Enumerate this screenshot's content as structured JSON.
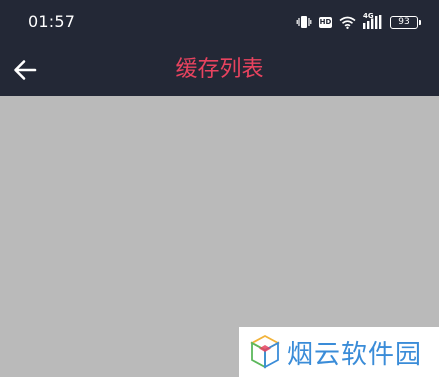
{
  "status_bar": {
    "time": "01:57",
    "hd_label": "HD",
    "network_label": "4G",
    "battery_level": "93",
    "icons": [
      "vibrate-icon",
      "hd-icon",
      "wifi-icon",
      "signal-4g-icon",
      "battery-icon"
    ]
  },
  "header": {
    "title": "缓存列表",
    "back_icon": "arrow-left-icon",
    "title_color": "#e8435f",
    "background": "#232836"
  },
  "content": {
    "background": "#bababa"
  },
  "watermark": {
    "text": "烟云软件园",
    "text_color": "#3a8cd8"
  }
}
